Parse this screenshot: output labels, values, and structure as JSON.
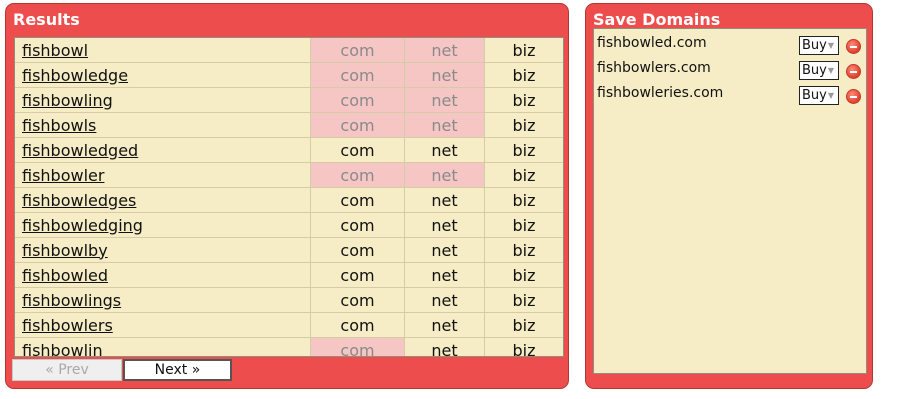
{
  "results": {
    "title": "Results",
    "rows": [
      {
        "base": "fishbowl",
        "suffix": "",
        "com": "com",
        "net": "net",
        "biz": "biz",
        "com_taken": true,
        "net_taken": true,
        "biz_taken": false
      },
      {
        "base": "fishbowl",
        "suffix": "edge",
        "com": "com",
        "net": "net",
        "biz": "biz",
        "com_taken": true,
        "net_taken": true,
        "biz_taken": false
      },
      {
        "base": "fishbowl",
        "suffix": "ing",
        "com": "com",
        "net": "net",
        "biz": "biz",
        "com_taken": true,
        "net_taken": true,
        "biz_taken": false
      },
      {
        "base": "fishbowl",
        "suffix": "s",
        "com": "com",
        "net": "net",
        "biz": "biz",
        "com_taken": true,
        "net_taken": true,
        "biz_taken": false
      },
      {
        "base": "fishbowl",
        "suffix": "edged",
        "com": "com",
        "net": "net",
        "biz": "biz",
        "com_taken": false,
        "net_taken": false,
        "biz_taken": false
      },
      {
        "base": "fishbowl",
        "suffix": "er",
        "com": "com",
        "net": "net",
        "biz": "biz",
        "com_taken": true,
        "net_taken": true,
        "biz_taken": false
      },
      {
        "base": "fishbowl",
        "suffix": "edges",
        "com": "com",
        "net": "net",
        "biz": "biz",
        "com_taken": false,
        "net_taken": false,
        "biz_taken": false
      },
      {
        "base": "fishbowl",
        "suffix": "edging",
        "com": "com",
        "net": "net",
        "biz": "biz",
        "com_taken": false,
        "net_taken": false,
        "biz_taken": false
      },
      {
        "base": "fishbowl",
        "suffix": "by",
        "com": "com",
        "net": "net",
        "biz": "biz",
        "com_taken": false,
        "net_taken": false,
        "biz_taken": false
      },
      {
        "base": "fishbowl",
        "suffix": "ed",
        "com": "com",
        "net": "net",
        "biz": "biz",
        "com_taken": false,
        "net_taken": false,
        "biz_taken": false
      },
      {
        "base": "fishbowl",
        "suffix": "ings",
        "com": "com",
        "net": "net",
        "biz": "biz",
        "com_taken": false,
        "net_taken": false,
        "biz_taken": false
      },
      {
        "base": "fishbowl",
        "suffix": "ers",
        "com": "com",
        "net": "net",
        "biz": "biz",
        "com_taken": false,
        "net_taken": false,
        "biz_taken": false
      },
      {
        "base": "fishbowl",
        "suffix": "in",
        "com": "com",
        "net": "net",
        "biz": "biz",
        "com_taken": true,
        "net_taken": false,
        "biz_taken": false
      }
    ],
    "prev_label": "« Prev",
    "next_label": "Next »"
  },
  "save_domains": {
    "title": "Save Domains",
    "items": [
      {
        "domain": "fishbowled.com",
        "buy_label": "Buy"
      },
      {
        "domain": "fishbowlers.com",
        "buy_label": "Buy"
      },
      {
        "domain": "fishbowleries.com",
        "buy_label": "Buy"
      }
    ],
    "buy_arrow_icon": "dropdown-arrow-icon",
    "remove_icon": "remove-circle-icon"
  },
  "colors": {
    "panel_red": "#ee4d4d",
    "content_bg": "#f6edc6",
    "taken_bg": "#f5c6c4",
    "taken_text": "#8a8a8a"
  }
}
